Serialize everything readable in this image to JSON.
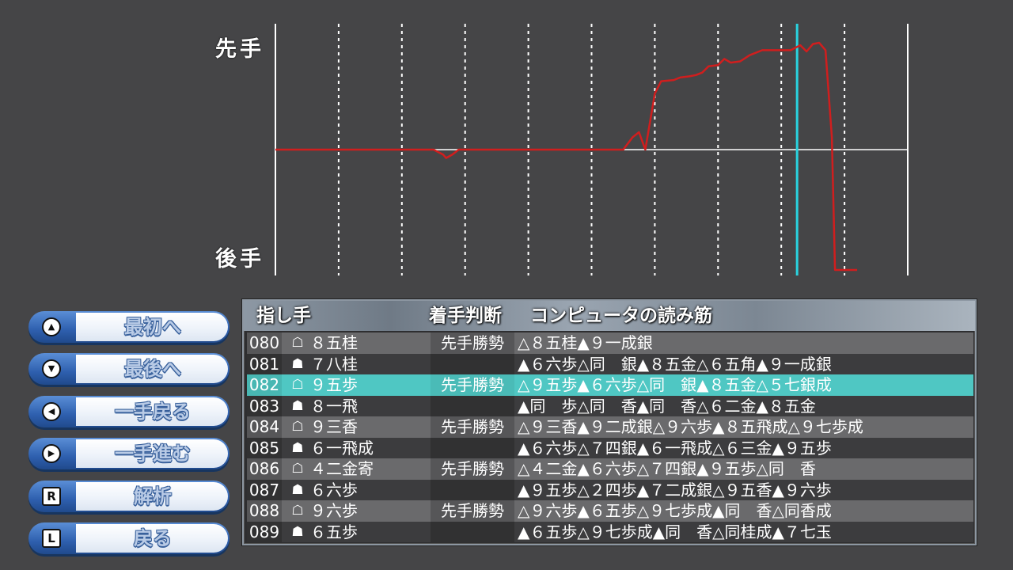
{
  "graph": {
    "label_top": "先手",
    "label_bottom": "後手",
    "line_color": "#d01e1e",
    "cursor_color": "#29d3e0"
  },
  "chart_data": {
    "type": "line",
    "series": [
      {
        "points": [
          [
            0,
            0
          ],
          [
            50,
            0
          ],
          [
            53,
            -0.04
          ],
          [
            54,
            -0.07
          ],
          [
            56,
            -0.04
          ],
          [
            58,
            0
          ],
          [
            110,
            0
          ],
          [
            113,
            0.1
          ],
          [
            115,
            0.14
          ],
          [
            117,
            0
          ],
          [
            120,
            0.45
          ],
          [
            122,
            0.55
          ],
          [
            126,
            0.56
          ],
          [
            128,
            0.58
          ],
          [
            131,
            0.59
          ],
          [
            133,
            0.6
          ],
          [
            135,
            0.62
          ],
          [
            137,
            0.67
          ],
          [
            140,
            0.68
          ],
          [
            142,
            0.73
          ],
          [
            144,
            0.7
          ],
          [
            147,
            0.71
          ],
          [
            150,
            0.76
          ],
          [
            154,
            0.8
          ],
          [
            160,
            0.8
          ],
          [
            163,
            0.8
          ],
          [
            166,
            0.84
          ],
          [
            168,
            0.79
          ],
          [
            170,
            0.85
          ],
          [
            172,
            0.86
          ],
          [
            174,
            0.8
          ],
          [
            176,
            0.1
          ],
          [
            177,
            -1.0
          ],
          [
            181,
            -1.0
          ],
          [
            184,
            -1.0
          ]
        ]
      }
    ],
    "x_range": [
      0,
      200
    ],
    "y_range": [
      -1,
      1
    ],
    "vertical_grid_count": 10,
    "cursor_move": 165
  },
  "buttons": [
    {
      "key": "up",
      "label": "最初へ"
    },
    {
      "key": "down",
      "label": "最後へ"
    },
    {
      "key": "left",
      "label": "一手戻る"
    },
    {
      "key": "right",
      "label": "一手進む"
    },
    {
      "key": "R",
      "label": "解析"
    },
    {
      "key": "L",
      "label": "戻る"
    }
  ],
  "table": {
    "headers": {
      "move": "指し手",
      "judge": "着手判断",
      "line": "コンピュータの読み筋"
    },
    "rows": [
      {
        "num": "080",
        "side": "gote",
        "move": "８五桂",
        "judge": "先手勝勢",
        "line": "△８五桂▲９一成銀"
      },
      {
        "num": "081",
        "side": "sente",
        "move": "７八桂",
        "judge": "",
        "line": "▲６六歩△同　銀▲８五金△６五角▲９一成銀"
      },
      {
        "num": "082",
        "side": "gote",
        "move": "９五歩",
        "judge": "先手勝勢",
        "line": "△９五歩▲６六歩△同　銀▲８五金△５七銀成",
        "selected": true
      },
      {
        "num": "083",
        "side": "sente",
        "move": "８一飛",
        "judge": "",
        "line": "▲同　歩△同　香▲同　香△６二金▲８五金"
      },
      {
        "num": "084",
        "side": "gote",
        "move": "９三香",
        "judge": "先手勝勢",
        "line": "△９三香▲９二成銀△９六歩▲８五飛成△９七歩成"
      },
      {
        "num": "085",
        "side": "sente",
        "move": "６一飛成",
        "judge": "",
        "line": "▲６六歩△７四銀▲６一飛成△６三金▲９五歩"
      },
      {
        "num": "086",
        "side": "gote",
        "move": "４二金寄",
        "judge": "先手勝勢",
        "line": "△４二金▲６六歩△７四銀▲９五歩△同　香"
      },
      {
        "num": "087",
        "side": "sente",
        "move": "６六歩",
        "judge": "",
        "line": "▲９五歩△２四歩▲７二成銀△９五香▲９六歩"
      },
      {
        "num": "088",
        "side": "gote",
        "move": "９六歩",
        "judge": "先手勝勢",
        "line": "△９六歩▲６五歩△９七歩成▲同　香△同香成"
      },
      {
        "num": "089",
        "side": "sente",
        "move": "６五歩",
        "judge": "",
        "line": "▲６五歩△９七歩成▲同　香△同桂成▲７七玉"
      }
    ]
  }
}
